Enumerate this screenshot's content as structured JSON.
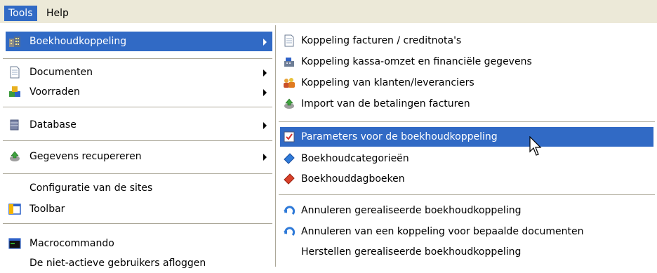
{
  "menubar": {
    "tools": "Tools",
    "help": "Help"
  },
  "main_menu": {
    "items": [
      {
        "label": "Boekhoudkoppeling",
        "icon": "building-icon"
      },
      {
        "label": "Documenten",
        "icon": "document-icon"
      },
      {
        "label": "Voorraden",
        "icon": "stock-icon"
      },
      {
        "label": "Database",
        "icon": "database-icon"
      },
      {
        "label": "Gegevens recupereren",
        "icon": "recover-icon"
      },
      {
        "label": "Configuratie van de sites"
      },
      {
        "label": "Toolbar",
        "icon": "toolbar-icon"
      },
      {
        "label": "Macrocommando",
        "icon": "terminal-icon"
      },
      {
        "label": "De niet-actieve gebruikers afloggen"
      }
    ]
  },
  "submenu": {
    "items": [
      {
        "label": "Koppeling facturen / creditnota's",
        "icon": "document-icon"
      },
      {
        "label": "Koppeling kassa-omzet en financiële gegevens",
        "icon": "cashregister-icon"
      },
      {
        "label": "Koppeling van klanten/leveranciers",
        "icon": "people-icon"
      },
      {
        "label": "Import van de betalingen facturen",
        "icon": "import-icon"
      },
      {
        "label": "Parameters voor de boekhoudkoppeling",
        "icon": "checklist-icon"
      },
      {
        "label": "Boekhoudcategorieën",
        "icon": "blue-book-icon"
      },
      {
        "label": "Boekhouddagboeken",
        "icon": "red-book-icon"
      },
      {
        "label": "Annuleren gerealiseerde boekhoudkoppeling",
        "icon": "undo-icon"
      },
      {
        "label": "Annuleren van een koppeling voor bepaalde documenten",
        "icon": "undo-icon"
      },
      {
        "label": "Herstellen gerealiseerde boekhoudkoppeling"
      }
    ]
  },
  "colors": {
    "highlight": "#316AC5",
    "menubar_bg": "#ECE9D8",
    "separator": "#ACA899"
  }
}
